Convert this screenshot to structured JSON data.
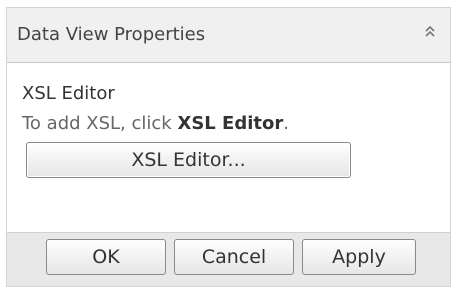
{
  "panel": {
    "title": "Data View Properties",
    "collapse_icon": "double-chevron-up-icon"
  },
  "xsl_section": {
    "title": "XSL Editor",
    "hint_prefix": "To add XSL, click ",
    "hint_bold": "XSL Editor",
    "hint_suffix": ".",
    "button_label": "XSL Editor..."
  },
  "footer": {
    "ok_label": "OK",
    "cancel_label": "Cancel",
    "apply_label": "Apply"
  }
}
